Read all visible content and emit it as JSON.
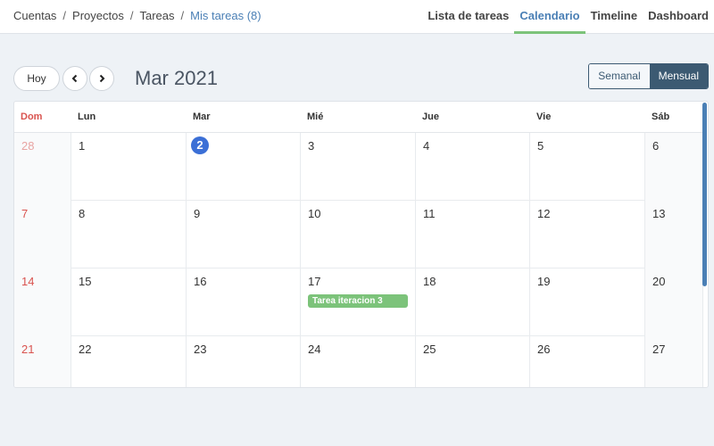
{
  "breadcrumb": [
    "Cuentas",
    "Proyectos",
    "Tareas",
    "Mis tareas (8)"
  ],
  "nav_tabs": [
    {
      "label": "Lista de tareas",
      "active": false
    },
    {
      "label": "Calendario",
      "active": true
    },
    {
      "label": "Timeline",
      "active": false
    },
    {
      "label": "Dashboard",
      "active": false
    }
  ],
  "toolbar": {
    "today_label": "Hoy",
    "prev_icon": "chevron-left-icon",
    "next_icon": "chevron-right-icon",
    "month_title": "Mar 2021",
    "views": [
      {
        "label": "Semanal",
        "active": false
      },
      {
        "label": "Mensual",
        "active": true
      }
    ]
  },
  "calendar": {
    "weekdays": [
      "Dom",
      "Lun",
      "Mar",
      "Mié",
      "Jue",
      "Vie",
      "Sáb"
    ],
    "weeks": [
      [
        "28",
        "1",
        "2",
        "3",
        "4",
        "5",
        "6"
      ],
      [
        "7",
        "8",
        "9",
        "10",
        "11",
        "12",
        "13"
      ],
      [
        "14",
        "15",
        "16",
        "17",
        "18",
        "19",
        "20"
      ],
      [
        "21",
        "22",
        "23",
        "24",
        "25",
        "26",
        "27"
      ]
    ],
    "today": "2",
    "other_month_days": [
      "28"
    ],
    "events": [
      {
        "label": "Tarea iteracion 3",
        "day": "17",
        "color": "#7cc37a"
      }
    ]
  },
  "colors": {
    "accent": "#4a7fb5",
    "today": "#3b6fd6",
    "sunday": "#d9534f",
    "active_tab_underline": "#7cc37a",
    "view_active": "#3c5a72"
  }
}
